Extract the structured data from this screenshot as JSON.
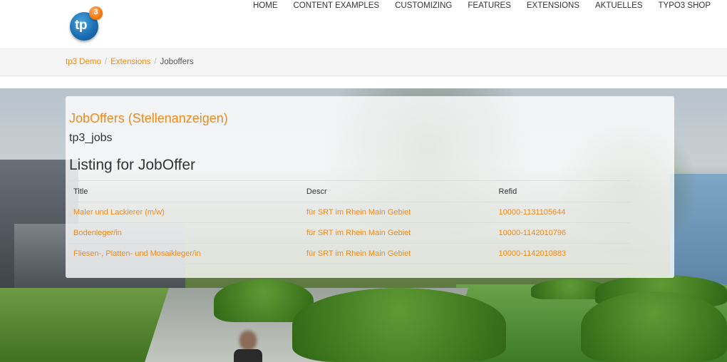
{
  "header": {
    "logo_text": "tp",
    "logo_badge": "3",
    "nav": [
      {
        "label": "HOME"
      },
      {
        "label": "CONTENT EXAMPLES"
      },
      {
        "label": "CUSTOMIZING"
      },
      {
        "label": "FEATURES"
      },
      {
        "label": "EXTENSIONS"
      },
      {
        "label": "AKTUELLES"
      },
      {
        "label": "TYPO3 SHOP"
      }
    ]
  },
  "breadcrumb": {
    "items": [
      {
        "label": "tp3 Demo"
      },
      {
        "label": "Extensions"
      },
      {
        "label": "Joboffers"
      }
    ],
    "separator": "/"
  },
  "content": {
    "extension_title": "JobOffers (Stellenanzeigen)",
    "extension_key": "tp3_jobs",
    "listing_title": "Listing for JobOffer",
    "table": {
      "headers": [
        "Title",
        "Descr",
        "Refid"
      ],
      "rows": [
        {
          "title": "Maler und Lackierer (m/w)",
          "descr": "für SRT im Rhein Main Gebiet",
          "refid": "10000-1131105644"
        },
        {
          "title": "Bodenleger/in",
          "descr": "für SRT im Rhein Main Gebiet",
          "refid": "10000-1142010796"
        },
        {
          "title": "Fliesen-, Platten- und Mosaikleger/in",
          "descr": "für SRT im Rhein Main Gebiet",
          "refid": "10000-1142010883"
        }
      ]
    }
  },
  "colors": {
    "accent": "#f08a1a",
    "text": "#333333",
    "breadcrumb_bg": "#f5f5f5"
  }
}
